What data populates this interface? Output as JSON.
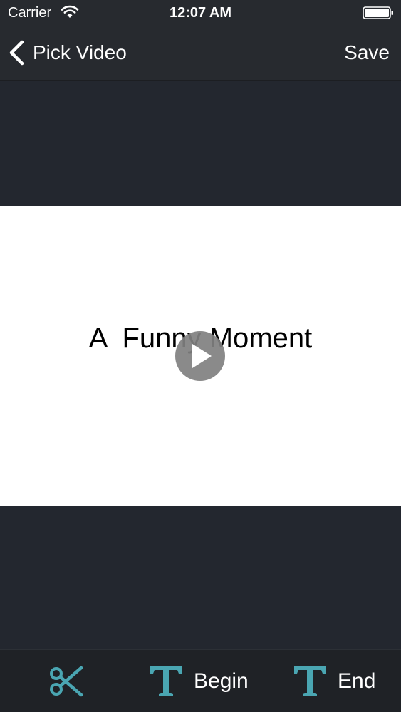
{
  "status_bar": {
    "carrier": "Carrier",
    "time": "12:07 AM",
    "wifi_icon": "wifi-icon",
    "battery_icon": "battery-icon"
  },
  "nav": {
    "back_label": "Pick Video",
    "back_icon": "chevron-left-icon",
    "save_label": "Save"
  },
  "video": {
    "title": "A  Funny Moment",
    "play_icon": "play-icon"
  },
  "toolbar": {
    "cut_icon": "scissors-icon",
    "begin_label": "Begin",
    "begin_icon": "text-t-icon",
    "end_label": "End",
    "end_icon": "text-t-icon"
  },
  "colors": {
    "background": "#23272f",
    "bar": "#272a2f",
    "toolbar": "#1f2226",
    "accent": "#4aa6b2",
    "text": "#ffffff"
  }
}
